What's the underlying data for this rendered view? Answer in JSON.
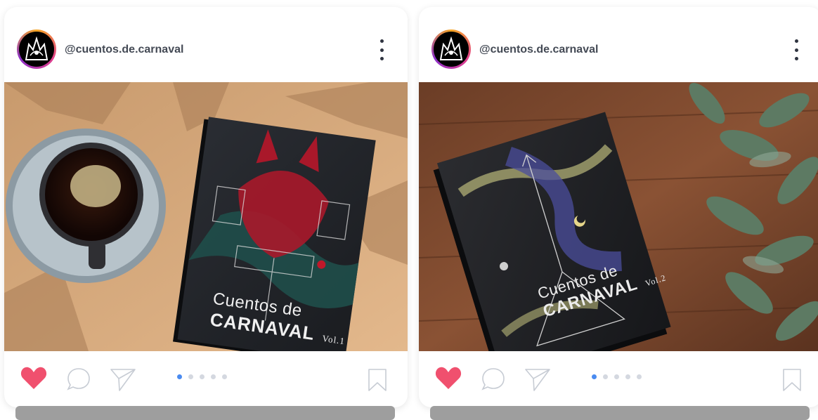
{
  "posts": [
    {
      "username": "@cuentos.de.carnaval",
      "book": {
        "title_line1": "Cuentos de",
        "title_line2": "CARNAVAL",
        "volume": "Vol.1"
      },
      "carousel": {
        "total": 5,
        "active": 1
      },
      "liked": true
    },
    {
      "username": "@cuentos.de.carnaval",
      "book": {
        "title_line1": "Cuentos de",
        "title_line2": "CARNAVAL",
        "volume": "Vol.2"
      },
      "carousel": {
        "total": 5,
        "active": 1
      },
      "liked": true
    }
  ],
  "colors": {
    "like": "#f0506e",
    "carousel_active": "#4a8bf0",
    "carousel_inactive": "#d4d8e0",
    "username": "#444a55"
  },
  "icons": [
    "more-vert-icon",
    "heart-icon",
    "comment-icon",
    "send-icon",
    "bookmark-icon"
  ]
}
